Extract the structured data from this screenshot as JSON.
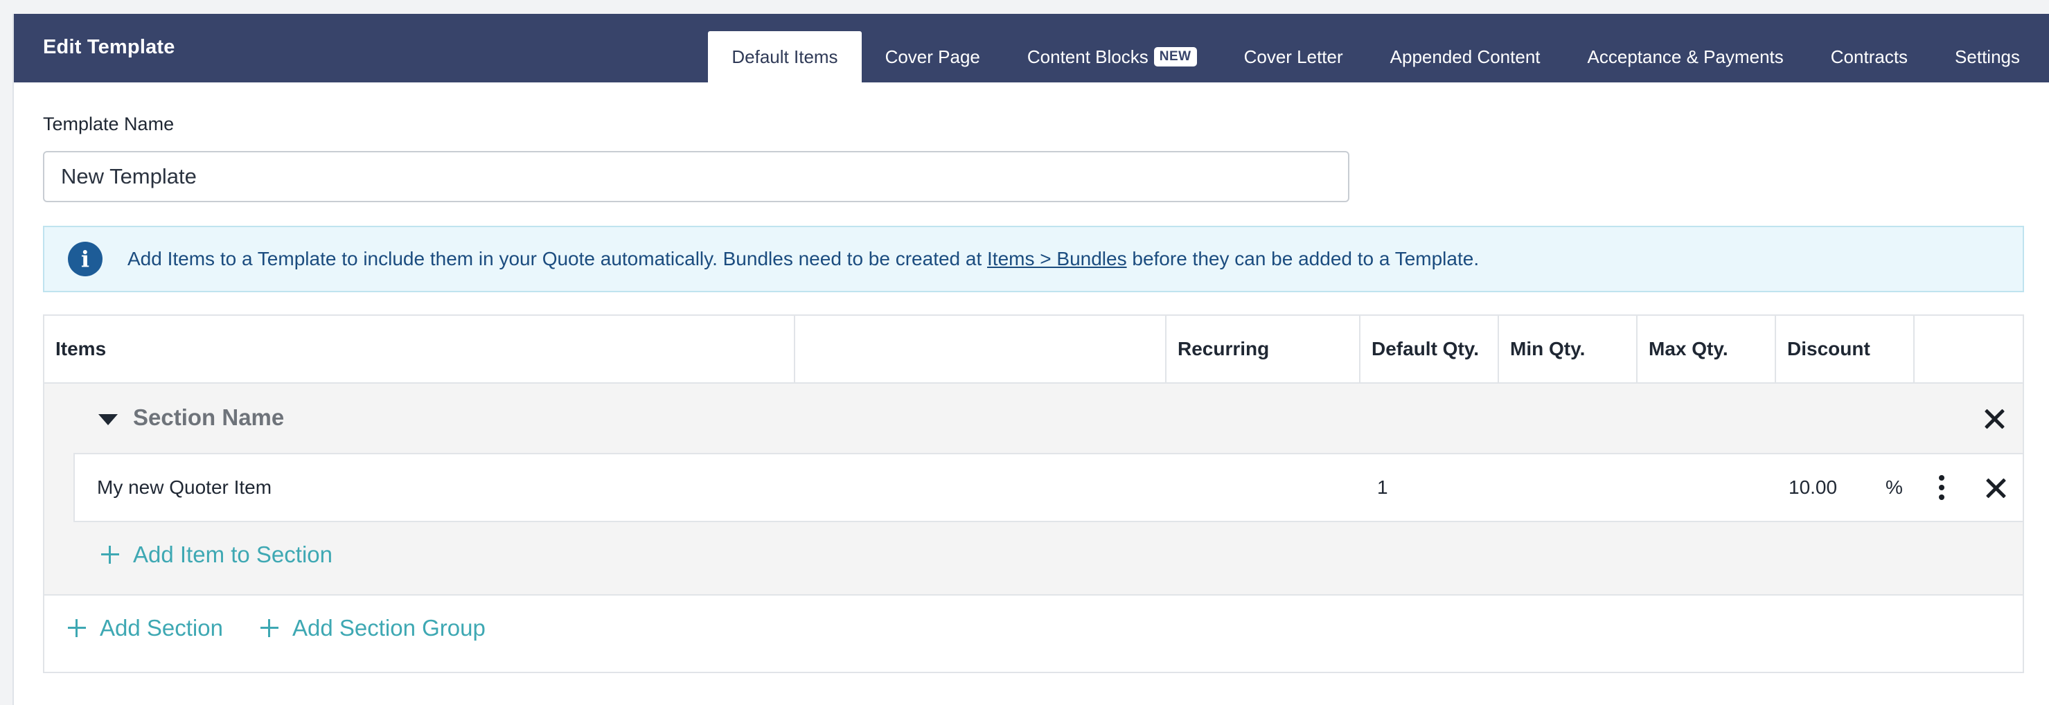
{
  "header": {
    "title": "Edit Template",
    "tabs": [
      {
        "label": "Default Items",
        "active": true
      },
      {
        "label": "Cover Page"
      },
      {
        "label": "Content Blocks",
        "badge": "NEW"
      },
      {
        "label": "Cover Letter"
      },
      {
        "label": "Appended Content"
      },
      {
        "label": "Acceptance & Payments"
      },
      {
        "label": "Contracts"
      },
      {
        "label": "Settings"
      }
    ]
  },
  "form": {
    "template_name_label": "Template Name",
    "template_name_value": "New Template"
  },
  "info": {
    "icon": "info-icon",
    "text_before": "Add Items to a Template to include them in your Quote automatically. Bundles need to be created at ",
    "link": "Items > Bundles",
    "text_after": " before they can be added to a Template."
  },
  "table": {
    "columns": [
      "Items",
      "",
      "Recurring",
      "Default Qty.",
      "Min Qty.",
      "Max Qty.",
      "Discount",
      ""
    ],
    "section": {
      "name": "Section Name",
      "items": [
        {
          "name": "My new Quoter Item",
          "default_qty": "1",
          "discount": "10.00",
          "discount_unit": "%"
        }
      ],
      "add_item_label": "Add Item to Section"
    },
    "add_section_label": "Add Section",
    "add_section_group_label": "Add Section Group"
  },
  "colors": {
    "header_bg": "#38446a",
    "accent_teal": "#3ea8b3",
    "info_bg": "#eaf7fc",
    "info_text": "#1b4c7f"
  }
}
